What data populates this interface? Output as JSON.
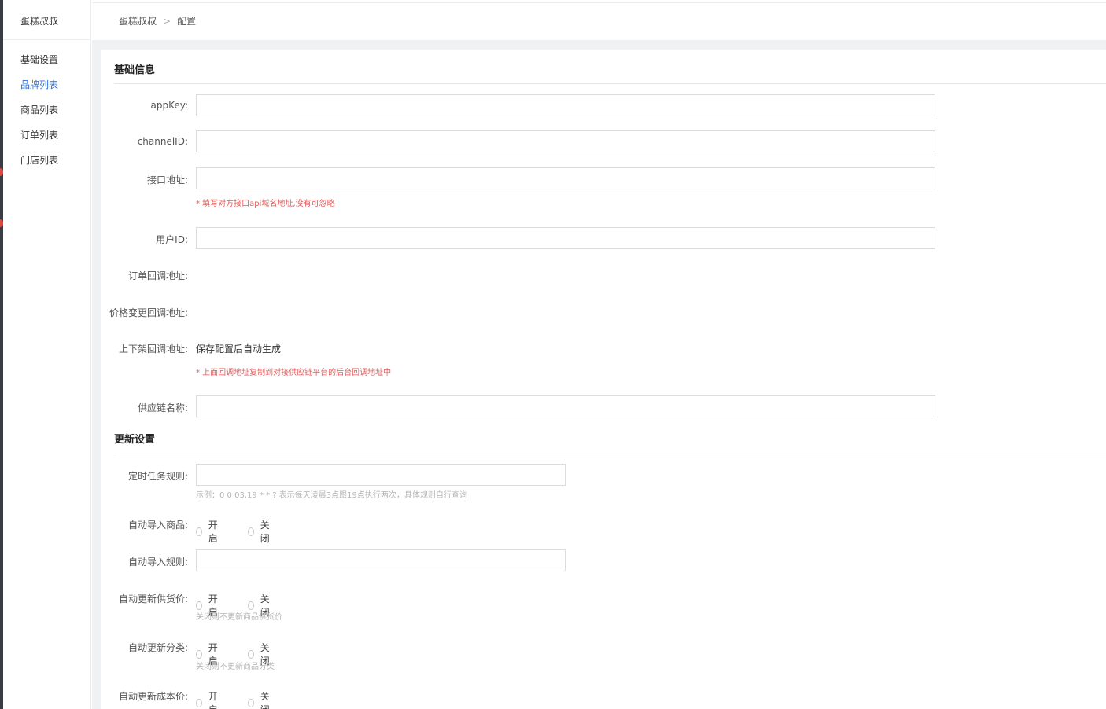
{
  "sidebar": {
    "brand": "蛋糕叔叔",
    "items": [
      {
        "label": "基础设置",
        "active": false
      },
      {
        "label": "品牌列表",
        "active": true
      },
      {
        "label": "商品列表",
        "active": false
      },
      {
        "label": "订单列表",
        "active": false
      },
      {
        "label": "门店列表",
        "active": false
      }
    ]
  },
  "breadcrumb": {
    "root": "蛋糕叔叔",
    "separator": ">",
    "current": "配置"
  },
  "basic": {
    "title": "基础信息",
    "appkey_label": "appKey:",
    "channel_label": "channelID:",
    "api_label": "接口地址:",
    "api_tip": "* 填写对方接口api域名地址,没有可忽略",
    "userid_label": "用户ID:",
    "order_callback_label": "订单回调地址:",
    "price_callback_label": "价格变更回调地址:",
    "shelf_callback_label": "上下架回调地址:",
    "shelf_callback_value": "保存配置后自动生成",
    "callback_tip": "* 上面回调地址复制到对接供应链平台的后台回调地址中",
    "supplier_label": "供应链名称:"
  },
  "update": {
    "title": "更新设置",
    "cron_label": "定时任务规则:",
    "cron_tip": "示例：0 0 03,19 * * ? 表示每天凌晨3点跟19点执行两次，具体规则自行查询",
    "auto_import_label": "自动导入商品:",
    "auto_import_rule_label": "自动导入规则:",
    "auto_supply_label": "自动更新供货价:",
    "auto_supply_tip": "关闭则不更新商品供货价",
    "auto_category_label": "自动更新分类:",
    "auto_category_tip": "关闭则不更新商品分类",
    "auto_cost_label": "自动更新成本价:",
    "on": "开启",
    "off": "关闭"
  },
  "colors": {
    "accent": "#2b6ed1",
    "tip_red": "#e05a5a",
    "background": "#f0f1f3"
  }
}
